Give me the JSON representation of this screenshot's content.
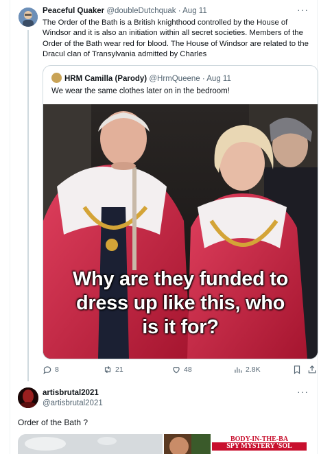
{
  "tweet": {
    "name": "Peaceful Quaker",
    "handle": "@doubleDutchquak",
    "separator": "·",
    "date": "Aug 11",
    "more": "···",
    "text": "The Order of the Bath is a British knighthood controlled by the House of Windsor and it is also an initiation within all secret societies. Members of the Order of the Bath wear red for blood. The House of Windsor are related to the Dracul clan of Transylvania admitted by Charles",
    "quote": {
      "name": "HRM Camilla (Parody)",
      "handle": "@HrmQueene",
      "separator": "·",
      "date": "Aug 11",
      "text": "We wear the same clothes later on in the bedroom!",
      "image_overlay": [
        "Why are they funded to",
        "dress up like this, who",
        "is it for?"
      ]
    },
    "actions": {
      "replies": "8",
      "retweets": "21",
      "likes": "48",
      "views": "2.8K",
      "bookmark_icon": "bookmark-icon",
      "share_icon": "share-icon"
    }
  },
  "reply": {
    "name": "artisbrutal2021",
    "handle": "@artisbrutal2021",
    "more": "···",
    "text": "Order of the Bath ?",
    "news_headline_1": "BODY-IN-THE-BA",
    "news_headline_2": "SPY MYSTERY 'SOL"
  },
  "colors": {
    "text": "#0f1419",
    "muted": "#536471",
    "border": "#cfd9de",
    "robe_red": "#d42a4a",
    "news_red": "#c8102e"
  }
}
